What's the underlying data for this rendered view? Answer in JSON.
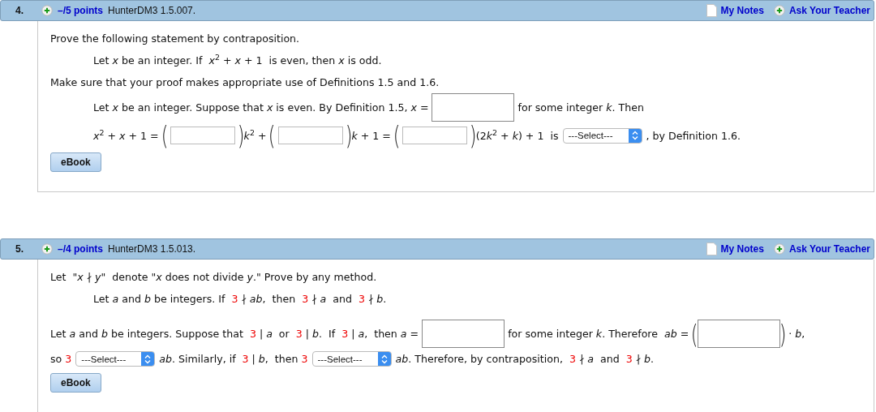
{
  "questions": [
    {
      "number": "4.",
      "points": "–/5 points",
      "code": "HunterDM3 1.5.007.",
      "notes": "My Notes",
      "ask": "Ask Your Teacher",
      "ebook": "eBook",
      "lines": [
        {
          "kind": "plain",
          "segments": [
            {
              "kind": "text",
              "text": "Prove the following statement by contraposition."
            }
          ]
        },
        {
          "kind": "indented",
          "segments": [
            {
              "kind": "text",
              "text": "Let *x* be an integer. If  *x*$^{2}$ + *x* + 1  is even, then *x* is odd."
            }
          ]
        },
        {
          "kind": "plain",
          "segments": [
            {
              "kind": "text",
              "text": "Make sure that your proof makes appropriate use of Definitions 1.5 and 1.6."
            }
          ]
        },
        {
          "kind": "indented",
          "segments": [
            {
              "kind": "text",
              "text": "Let *x* be an integer. Suppose that *x* is even. By Definition 1.5, *x* = "
            },
            {
              "kind": "box"
            },
            {
              "kind": "text",
              "text": " for some integer *k*. Then"
            }
          ]
        },
        {
          "kind": "indented",
          "segments": [
            {
              "kind": "text",
              "text": "*x*$^{2}$ + *x* + 1 = "
            },
            {
              "kind": "paren",
              "text": "("
            },
            {
              "kind": "field"
            },
            {
              "kind": "paren",
              "text": ")"
            },
            {
              "kind": "text",
              "text": "*k*$^{2}$ + "
            },
            {
              "kind": "paren",
              "text": "("
            },
            {
              "kind": "field"
            },
            {
              "kind": "paren",
              "text": ")"
            },
            {
              "kind": "text",
              "text": "*k* + 1 = "
            },
            {
              "kind": "paren",
              "text": "("
            },
            {
              "kind": "field"
            },
            {
              "kind": "paren",
              "text": ")"
            },
            {
              "kind": "text",
              "text": "(2"
            },
            {
              "kind": "text",
              "text": "*k*$^{2}$ + *k*) + 1  is"
            },
            {
              "kind": "select",
              "value": "---Select---"
            },
            {
              "kind": "text",
              "text": ", by Definition 1.6."
            }
          ]
        }
      ]
    },
    {
      "number": "5.",
      "points": "–/4 points",
      "code": "HunterDM3 1.5.013.",
      "notes": "My Notes",
      "ask": "Ask Your Teacher",
      "ebook": "eBook",
      "lines": [
        {
          "kind": "plain",
          "segments": [
            {
              "kind": "text",
              "text": "Let  \"*x* ∤ *y*\"  denote \"*x* does not divide *y*.\" Prove by any method."
            }
          ]
        },
        {
          "kind": "indented",
          "segments": [
            {
              "kind": "text",
              "text": "Let *a* and *b* be integers. If  "
            },
            {
              "kind": "red",
              "text": "3"
            },
            {
              "kind": "text",
              "text": " ∤ *ab*,  then  "
            },
            {
              "kind": "red",
              "text": "3"
            },
            {
              "kind": "text",
              "text": " ∤ *a*  and  "
            },
            {
              "kind": "red",
              "text": "3"
            },
            {
              "kind": "text",
              "text": " ∤ *b*."
            }
          ]
        },
        {
          "kind": "spaced",
          "segments": [
            {
              "kind": "text",
              "text": "Let *a* and *b* be integers. Suppose that  "
            },
            {
              "kind": "red",
              "text": "3"
            },
            {
              "kind": "text",
              "text": " | *a*  or  "
            },
            {
              "kind": "red",
              "text": "3"
            },
            {
              "kind": "text",
              "text": " | *b*.  If  "
            },
            {
              "kind": "red",
              "text": "3"
            },
            {
              "kind": "text",
              "text": " | *a*,  then *a* = "
            },
            {
              "kind": "box"
            },
            {
              "kind": "text",
              "text": " for some integer *k*. Therefore  *ab* = "
            },
            {
              "kind": "paren",
              "text": "("
            },
            {
              "kind": "box"
            },
            {
              "kind": "paren",
              "text": ")"
            },
            {
              "kind": "text",
              "text": " · *b*,"
            }
          ]
        },
        {
          "kind": "plain",
          "segments": [
            {
              "kind": "text",
              "text": "so "
            },
            {
              "kind": "red",
              "text": "3"
            },
            {
              "kind": "select",
              "value": "---Select---"
            },
            {
              "kind": "text",
              "text": "*ab*. Similarly, if  "
            },
            {
              "kind": "red",
              "text": "3"
            },
            {
              "kind": "text",
              "text": " | *b*,  then "
            },
            {
              "kind": "red",
              "text": "3"
            },
            {
              "kind": "select",
              "value": "---Select---"
            },
            {
              "kind": "text",
              "text": "*ab*. Therefore, by contraposition,  "
            },
            {
              "kind": "red",
              "text": "3"
            },
            {
              "kind": "text",
              "text": " ∤ *a*  and  "
            },
            {
              "kind": "red",
              "text": "3"
            },
            {
              "kind": "text",
              "text": " ∤ *b*."
            }
          ]
        }
      ]
    }
  ]
}
